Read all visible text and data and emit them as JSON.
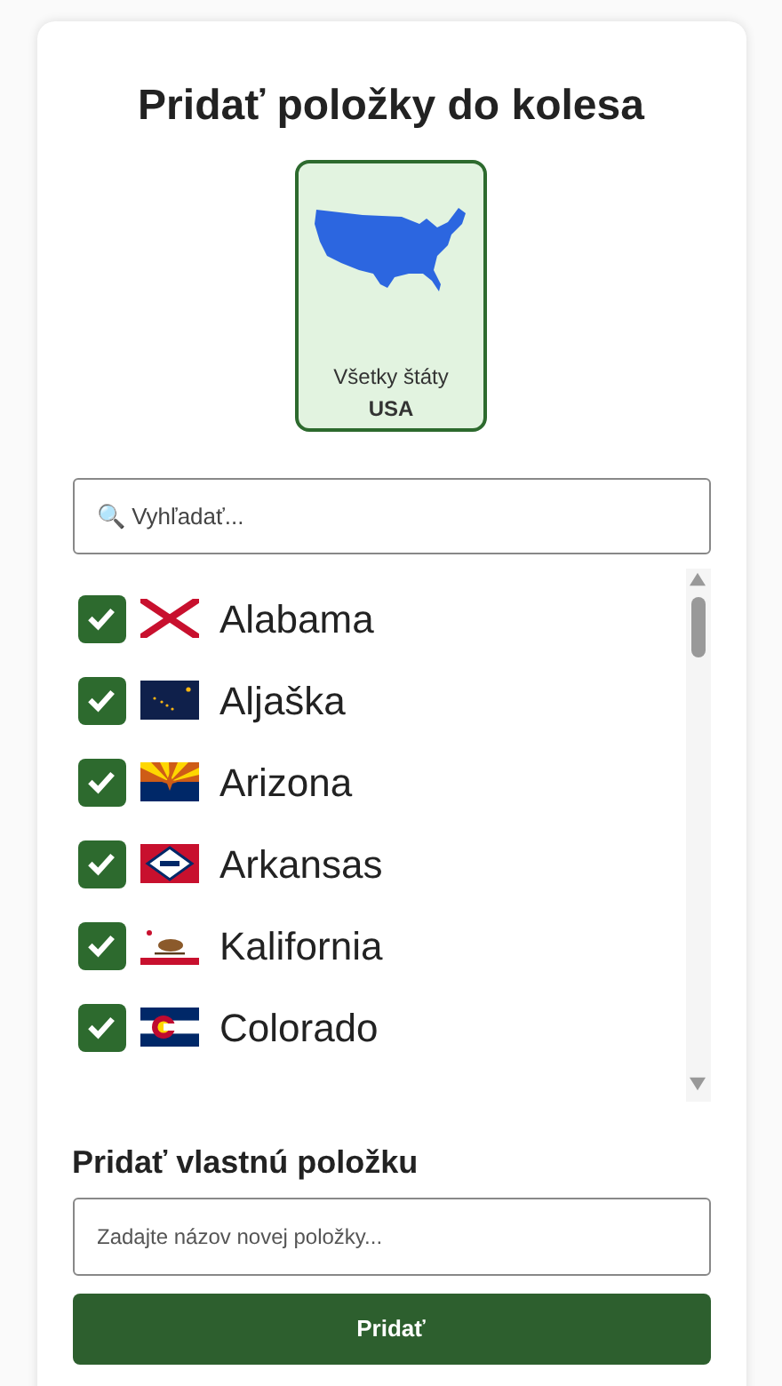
{
  "title": "Pridať položky do kolesa",
  "category": {
    "label": "Všetky štáty",
    "sublabel": "USA",
    "selected": true
  },
  "search": {
    "placeholder": "🔍 Vyhľadať..."
  },
  "items": [
    {
      "name": "Alabama",
      "checked": true,
      "kind": "alabama"
    },
    {
      "name": "Aljaška",
      "checked": true,
      "kind": "alaska"
    },
    {
      "name": "Arizona",
      "checked": true,
      "kind": "arizona"
    },
    {
      "name": "Arkansas",
      "checked": true,
      "kind": "arkansas"
    },
    {
      "name": "Kalifornia",
      "checked": true,
      "kind": "california"
    },
    {
      "name": "Colorado",
      "checked": true,
      "kind": "colorado"
    }
  ],
  "custom": {
    "heading": "Pridať vlastnú položku",
    "placeholder": "Zadajte názov novej položky...",
    "button": "Pridať"
  }
}
